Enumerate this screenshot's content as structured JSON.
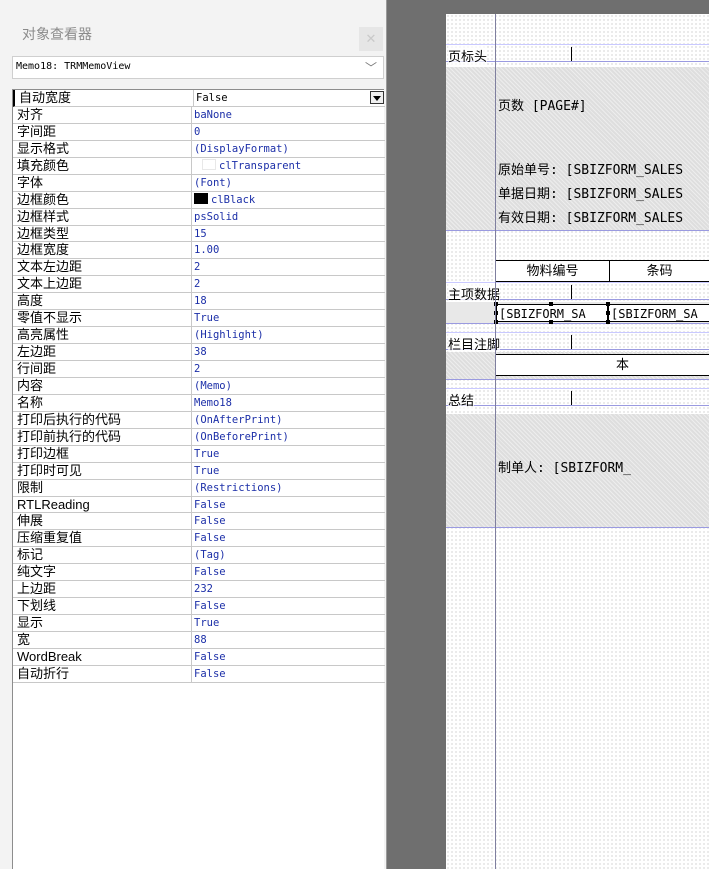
{
  "inspector": {
    "title": "对象查看器",
    "close_icon": "close-icon",
    "object_selector": "Memo18: TRMMemoView",
    "properties": [
      {
        "name": "自动宽度",
        "value": "False",
        "selected": true,
        "dropdown": true
      },
      {
        "name": "对齐",
        "value": "baNone"
      },
      {
        "name": "字间距",
        "value": "0"
      },
      {
        "name": "显示格式",
        "value": "(DisplayFormat)"
      },
      {
        "name": "填充颜色",
        "value": "clTransparent",
        "swatch": "transparent"
      },
      {
        "name": "字体",
        "value": "(Font)"
      },
      {
        "name": "边框颜色",
        "value": "clBlack",
        "swatch": "black"
      },
      {
        "name": "边框样式",
        "value": "psSolid"
      },
      {
        "name": "边框类型",
        "value": "15"
      },
      {
        "name": "边框宽度",
        "value": "1.00"
      },
      {
        "name": "文本左边距",
        "value": "2"
      },
      {
        "name": "文本上边距",
        "value": "2"
      },
      {
        "name": "高度",
        "value": "18"
      },
      {
        "name": "零值不显示",
        "value": "True"
      },
      {
        "name": "高亮属性",
        "value": "(Highlight)"
      },
      {
        "name": "左边距",
        "value": "38"
      },
      {
        "name": "行间距",
        "value": "2"
      },
      {
        "name": "内容",
        "value": "(Memo)"
      },
      {
        "name": "名称",
        "value": "Memo18"
      },
      {
        "name": "打印后执行的代码",
        "value": "(OnAfterPrint)"
      },
      {
        "name": "打印前执行的代码",
        "value": "(OnBeforePrint)"
      },
      {
        "name": "打印边框",
        "value": "True"
      },
      {
        "name": "打印时可见",
        "value": "True"
      },
      {
        "name": "限制",
        "value": "(Restrictions)"
      },
      {
        "name": "RTLReading",
        "value": "False"
      },
      {
        "name": "伸展",
        "value": "False"
      },
      {
        "name": "压缩重复值",
        "value": "False"
      },
      {
        "name": "标记",
        "value": "(Tag)"
      },
      {
        "name": "纯文字",
        "value": "False"
      },
      {
        "name": "上边距",
        "value": "232"
      },
      {
        "name": "下划线",
        "value": "False"
      },
      {
        "name": "显示",
        "value": "True"
      },
      {
        "name": "宽",
        "value": "88"
      },
      {
        "name": "WordBreak",
        "value": "False"
      },
      {
        "name": "自动折行",
        "value": "False"
      }
    ]
  },
  "designer": {
    "bands": {
      "page_header": "页标头",
      "master_data": "主项数据",
      "column_footer": "栏目注脚",
      "summary": "总结"
    },
    "page_number": "页数 [PAGE#]",
    "header_lines": [
      "原始单号: [SBIZFORM_SALES",
      "单据日期: [SBIZFORM_SALES",
      "有效日期: [SBIZFORM_SALES"
    ],
    "column_headers": [
      "物料编号",
      "条码"
    ],
    "data_fields": [
      "[SBIZFORM_SA",
      "[SBIZFORM_SA"
    ],
    "footer_text": "本",
    "maker": "制单人: [SBIZFORM_"
  }
}
